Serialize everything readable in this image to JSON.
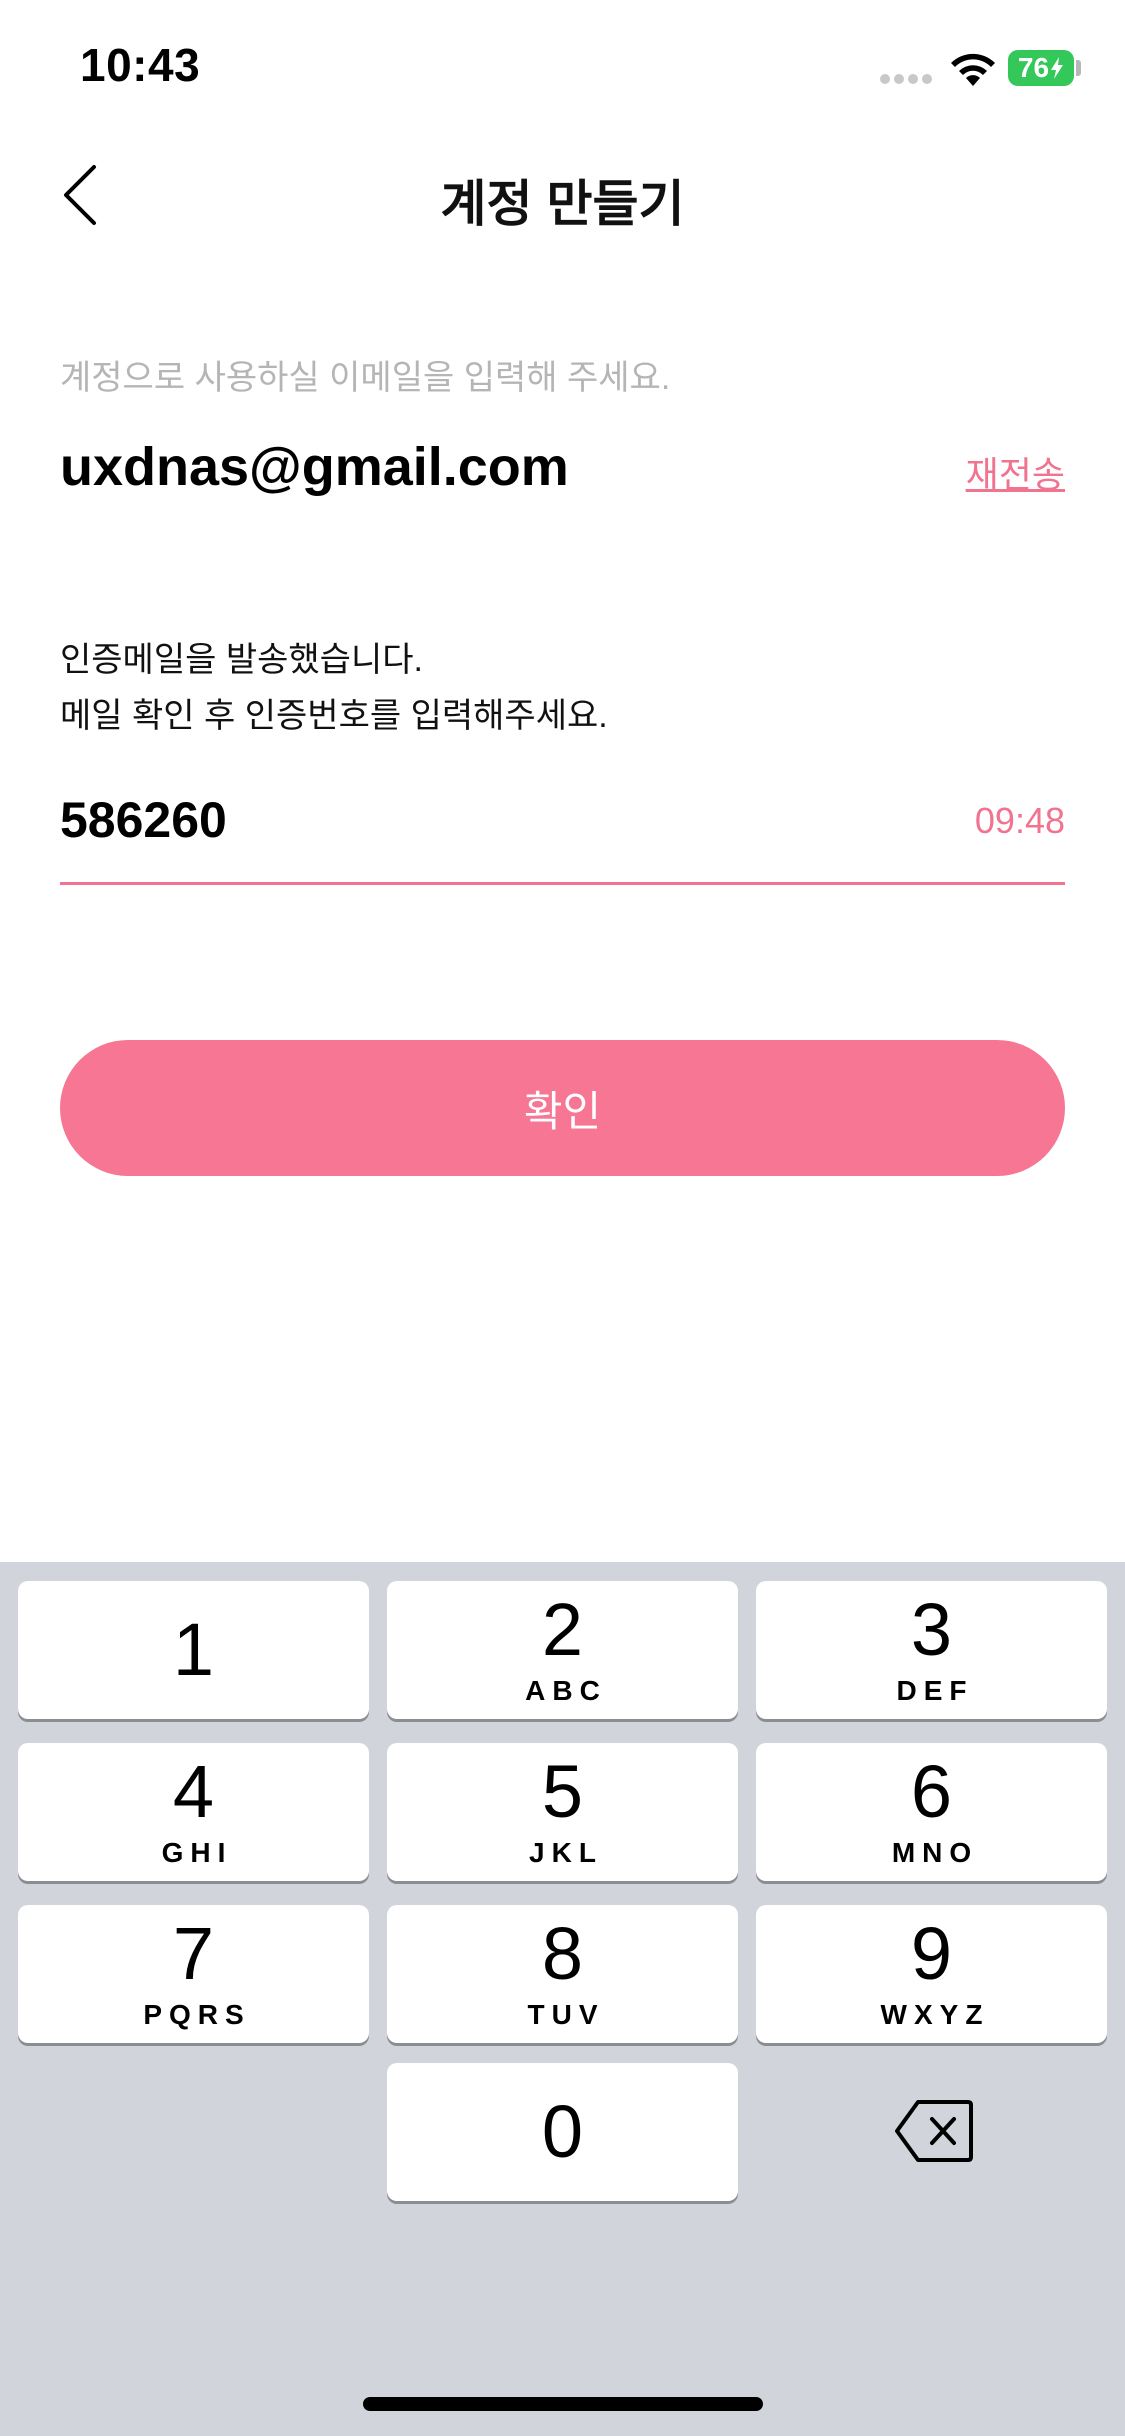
{
  "status_bar": {
    "time": "10:43",
    "battery": "76"
  },
  "header": {
    "title": "계정 만들기",
    "back_icon": "chevron-left-icon"
  },
  "email": {
    "hint": "계정으로 사용하실 이메일을 입력해 주세요.",
    "value": "uxdnas@gmail.com",
    "resend_label": "재전송"
  },
  "verification": {
    "message_line1": "인증메일을 발송했습니다.",
    "message_line2": "메일 확인 후 인증번호를 입력해주세요.",
    "code_value": "586260",
    "timer": "09:48"
  },
  "confirm_label": "확인",
  "keyboard": {
    "keys": [
      {
        "num": "1",
        "letters": ""
      },
      {
        "num": "2",
        "letters": "ABC"
      },
      {
        "num": "3",
        "letters": "DEF"
      },
      {
        "num": "4",
        "letters": "GHI"
      },
      {
        "num": "5",
        "letters": "JKL"
      },
      {
        "num": "6",
        "letters": "MNO"
      },
      {
        "num": "7",
        "letters": "PQRS"
      },
      {
        "num": "8",
        "letters": "TUV"
      },
      {
        "num": "9",
        "letters": "WXYZ"
      },
      {
        "num": "0",
        "letters": ""
      }
    ],
    "delete_icon": "backspace-icon"
  },
  "colors": {
    "accent": "#f67694",
    "accent_text": "#f0748f",
    "keyboard_bg": "#d1d4db",
    "battery": "#34c759"
  }
}
